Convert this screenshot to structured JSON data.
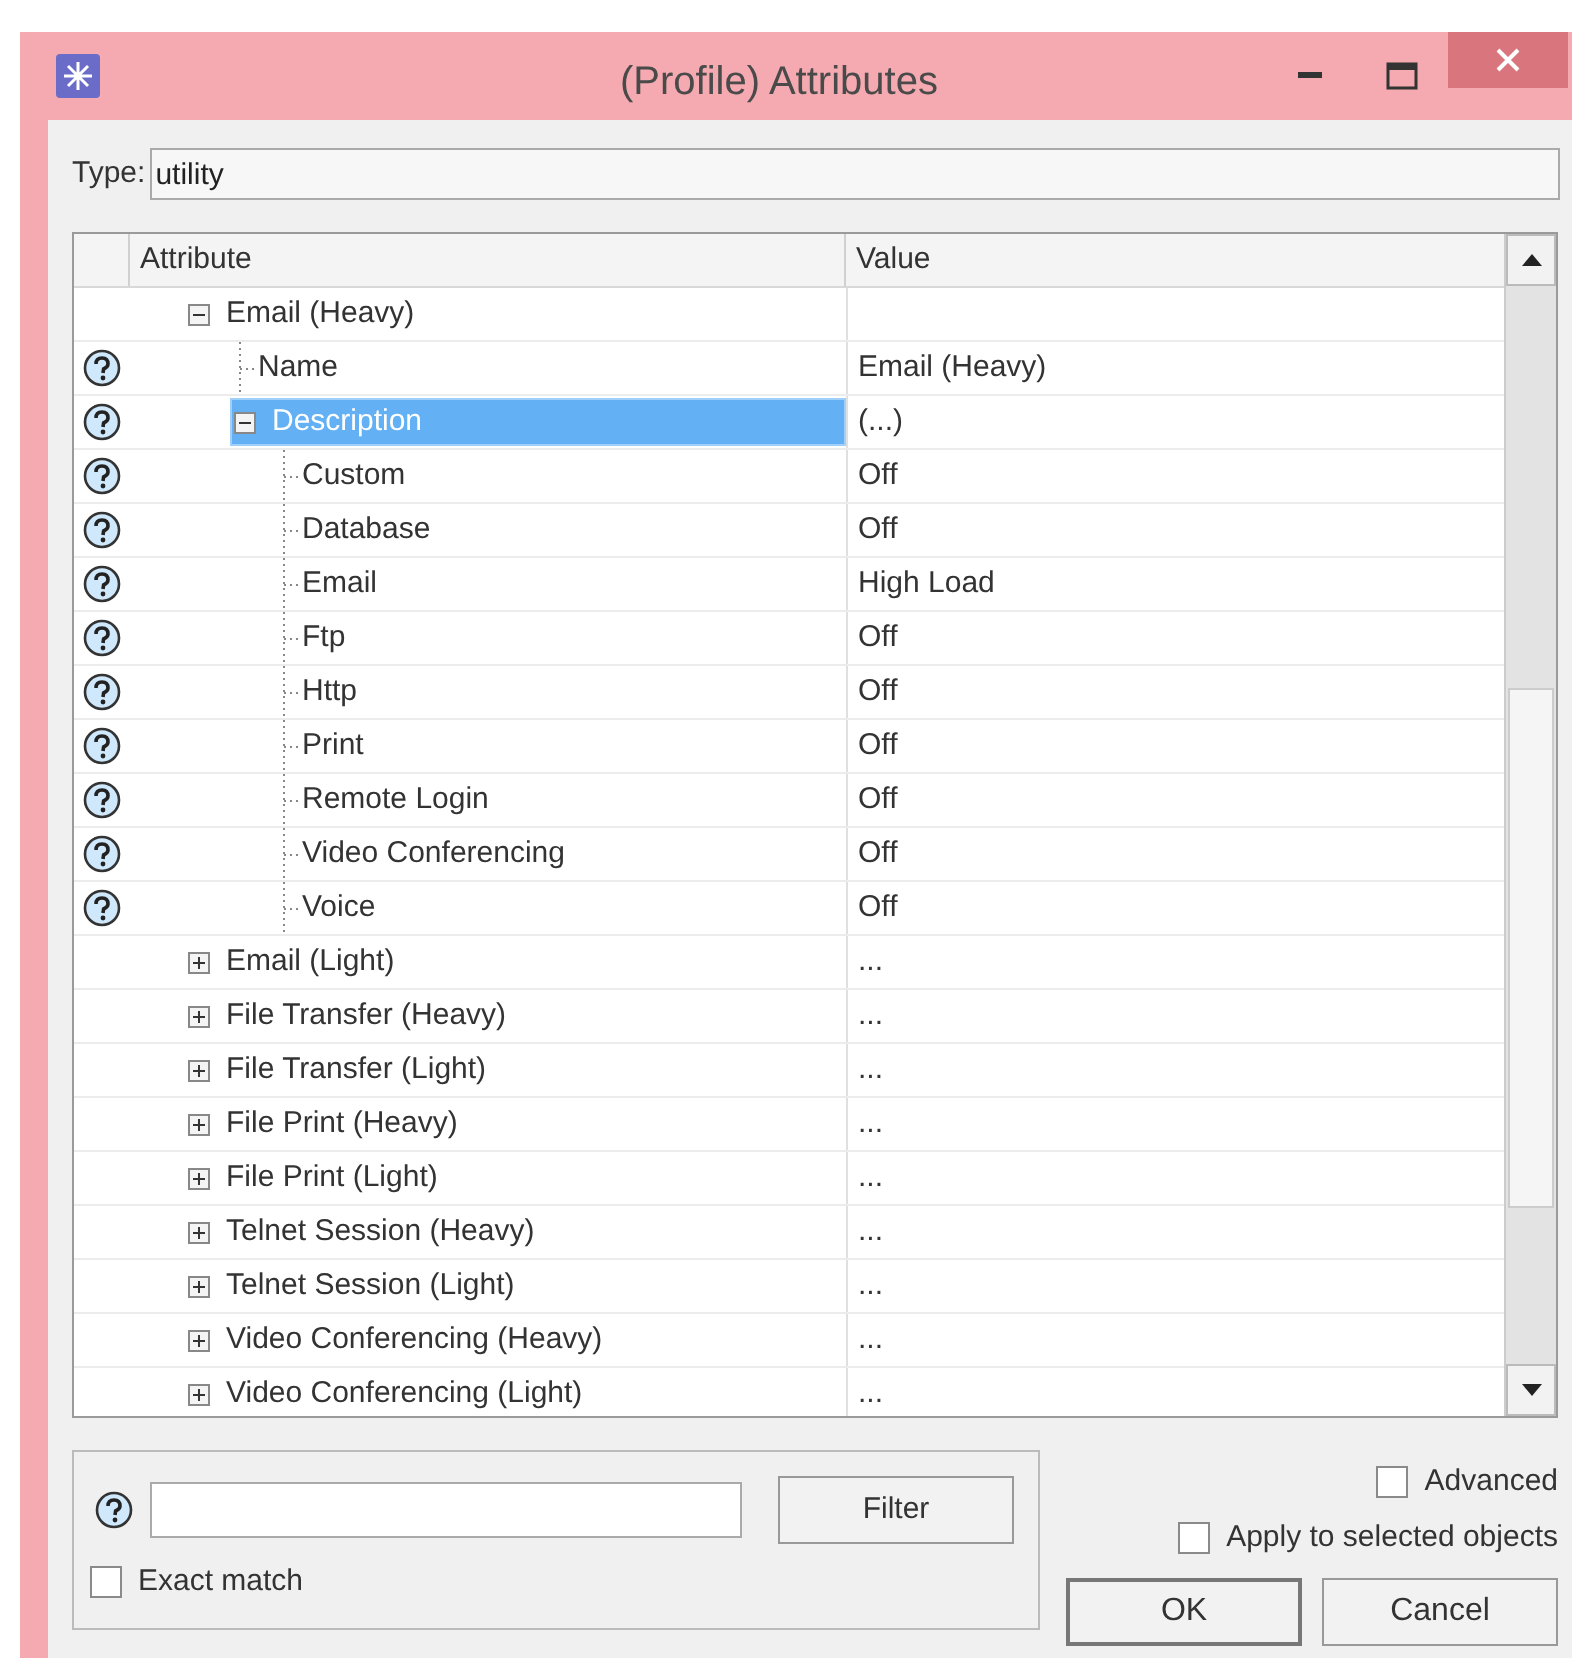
{
  "window": {
    "title": "(Profile) Attributes"
  },
  "type_field": {
    "label": "Type:",
    "value": "utility"
  },
  "table": {
    "columns": [
      "Attribute",
      "Value"
    ],
    "rows": [
      {
        "label": "Email (Heavy)",
        "help": false,
        "expanded": true,
        "selected": false,
        "children": [
          {
            "label": "Name",
            "value": "Email (Heavy)",
            "help": true,
            "selected": false
          },
          {
            "label": "Description",
            "value": "(...)",
            "help": true,
            "expanded": true,
            "selected": true,
            "children": [
              {
                "label": "Custom",
                "value": "Off",
                "help": true,
                "selected": false
              },
              {
                "label": "Database",
                "value": "Off",
                "help": true,
                "selected": false
              },
              {
                "label": "Email",
                "value": "High Load",
                "help": true,
                "selected": false
              },
              {
                "label": "Ftp",
                "value": "Off",
                "help": true,
                "selected": false
              },
              {
                "label": "Http",
                "value": "Off",
                "help": true,
                "selected": false
              },
              {
                "label": "Print",
                "value": "Off",
                "help": true,
                "selected": false
              },
              {
                "label": "Remote Login",
                "value": "Off",
                "help": true,
                "selected": false
              },
              {
                "label": "Video Conferencing",
                "value": "Off",
                "help": true,
                "selected": false
              },
              {
                "label": "Voice",
                "value": "Off",
                "help": true,
                "selected": false
              }
            ]
          }
        ]
      },
      {
        "label": "Email (Light)",
        "value": "...",
        "help": false,
        "expanded": false,
        "selected": false
      },
      {
        "label": "File Transfer (Heavy)",
        "value": "...",
        "help": false,
        "expanded": false,
        "selected": false
      },
      {
        "label": "File Transfer (Light)",
        "value": "...",
        "help": false,
        "expanded": false,
        "selected": false
      },
      {
        "label": "File Print (Heavy)",
        "value": "...",
        "help": false,
        "expanded": false,
        "selected": false
      },
      {
        "label": "File Print (Light)",
        "value": "...",
        "help": false,
        "expanded": false,
        "selected": false
      },
      {
        "label": "Telnet Session (Heavy)",
        "value": "...",
        "help": false,
        "expanded": false,
        "selected": false
      },
      {
        "label": "Telnet Session (Light)",
        "value": "...",
        "help": false,
        "expanded": false,
        "selected": false
      },
      {
        "label": "Video Conferencing (Heavy)",
        "value": "...",
        "help": false,
        "expanded": false,
        "selected": false
      },
      {
        "label": "Video Conferencing (Light)",
        "value": "...",
        "help": false,
        "expanded": false,
        "selected": false
      }
    ]
  },
  "filter": {
    "button": "Filter",
    "exact_match": {
      "label": "Exact match",
      "checked": false
    }
  },
  "options": [
    {
      "label": "Advanced",
      "checked": false
    },
    {
      "label": "Apply to selected objects",
      "checked": false
    }
  ],
  "buttons": [
    "OK",
    "Cancel"
  ]
}
